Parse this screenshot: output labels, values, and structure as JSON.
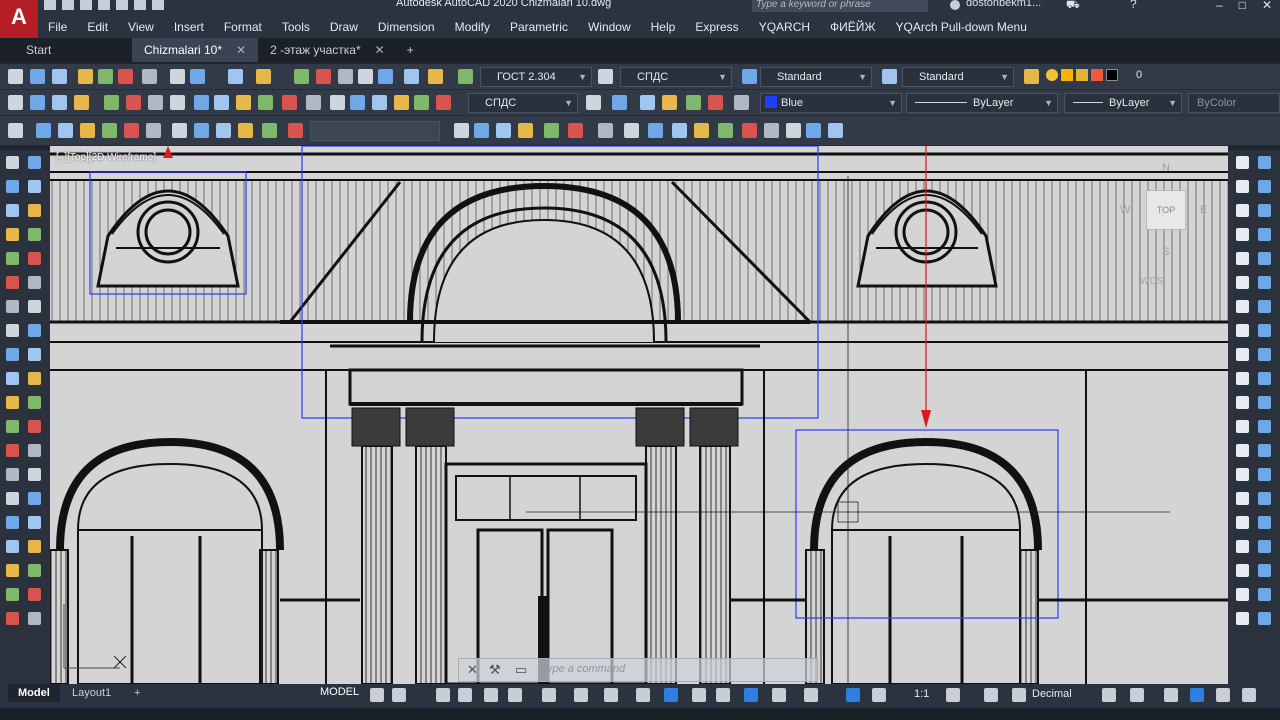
{
  "app": {
    "logo": "A",
    "title": "Autodesk AutoCAD 2020    Chizmalari 10.dwg",
    "search_placeholder": "Type a keyword or phrase",
    "user": "dostonbekm1..."
  },
  "menu": [
    "File",
    "Edit",
    "View",
    "Insert",
    "Format",
    "Tools",
    "Draw",
    "Dimension",
    "Modify",
    "Parametric",
    "Window",
    "Help",
    "Express",
    "YQARCH",
    "ФИЁЙЖ",
    "YQArch Pull-down Menu"
  ],
  "tabs": [
    {
      "label": "Start",
      "closable": false,
      "active": false
    },
    {
      "label": "Chizmalari 10*",
      "closable": true,
      "active": true
    },
    {
      "label": "2 -этаж участка*",
      "closable": true,
      "active": false
    }
  ],
  "toolbar": {
    "text_style": "ГОСТ 2.304",
    "dim_style": "СПДС",
    "table_style": "Standard",
    "multileader_style": "Standard",
    "layer_name": "0",
    "layer_state": "СПДС",
    "color": "Blue",
    "color_hex": "#1f3fff",
    "linetype": "ByLayer",
    "lineweight": "ByLayer",
    "plot_style": "ByColor"
  },
  "viewport": {
    "label": "[–][Top][2D Wireframe]",
    "viewcube_face": "TOP",
    "compass_n": "N",
    "compass_s": "S",
    "compass_w": "W",
    "compass_e": "E",
    "wcs": "WCS"
  },
  "command": {
    "placeholder": "Type a command"
  },
  "status": {
    "layouts": [
      "Model",
      "Layout1"
    ],
    "space": "MODEL",
    "annotation_scale": "1:1",
    "units": "Decimal"
  }
}
